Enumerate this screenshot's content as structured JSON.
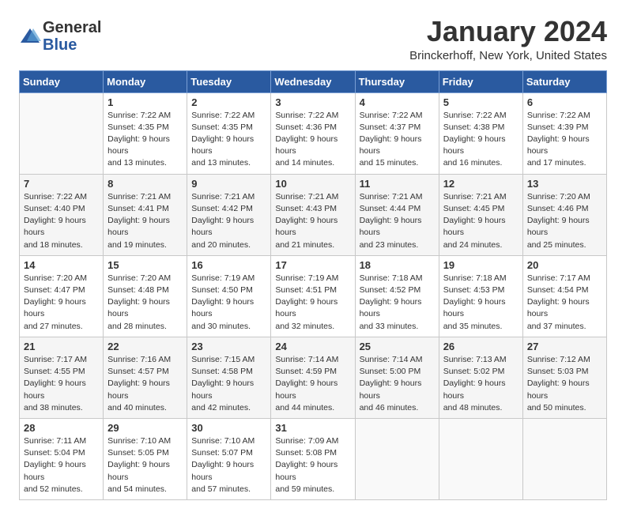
{
  "logo": {
    "general": "General",
    "blue": "Blue"
  },
  "header": {
    "month_title": "January 2024",
    "location": "Brinckerhoff, New York, United States"
  },
  "days_of_week": [
    "Sunday",
    "Monday",
    "Tuesday",
    "Wednesday",
    "Thursday",
    "Friday",
    "Saturday"
  ],
  "weeks": [
    [
      {
        "day": null,
        "data": null
      },
      {
        "day": "1",
        "data": "Sunrise: 7:22 AM\nSunset: 4:35 PM\nDaylight: 9 hours and 13 minutes."
      },
      {
        "day": "2",
        "data": "Sunrise: 7:22 AM\nSunset: 4:35 PM\nDaylight: 9 hours and 13 minutes."
      },
      {
        "day": "3",
        "data": "Sunrise: 7:22 AM\nSunset: 4:36 PM\nDaylight: 9 hours and 14 minutes."
      },
      {
        "day": "4",
        "data": "Sunrise: 7:22 AM\nSunset: 4:37 PM\nDaylight: 9 hours and 15 minutes."
      },
      {
        "day": "5",
        "data": "Sunrise: 7:22 AM\nSunset: 4:38 PM\nDaylight: 9 hours and 16 minutes."
      },
      {
        "day": "6",
        "data": "Sunrise: 7:22 AM\nSunset: 4:39 PM\nDaylight: 9 hours and 17 minutes."
      }
    ],
    [
      {
        "day": "7",
        "data": "Sunrise: 7:22 AM\nSunset: 4:40 PM\nDaylight: 9 hours and 18 minutes."
      },
      {
        "day": "8",
        "data": "Sunrise: 7:21 AM\nSunset: 4:41 PM\nDaylight: 9 hours and 19 minutes."
      },
      {
        "day": "9",
        "data": "Sunrise: 7:21 AM\nSunset: 4:42 PM\nDaylight: 9 hours and 20 minutes."
      },
      {
        "day": "10",
        "data": "Sunrise: 7:21 AM\nSunset: 4:43 PM\nDaylight: 9 hours and 21 minutes."
      },
      {
        "day": "11",
        "data": "Sunrise: 7:21 AM\nSunset: 4:44 PM\nDaylight: 9 hours and 23 minutes."
      },
      {
        "day": "12",
        "data": "Sunrise: 7:21 AM\nSunset: 4:45 PM\nDaylight: 9 hours and 24 minutes."
      },
      {
        "day": "13",
        "data": "Sunrise: 7:20 AM\nSunset: 4:46 PM\nDaylight: 9 hours and 25 minutes."
      }
    ],
    [
      {
        "day": "14",
        "data": "Sunrise: 7:20 AM\nSunset: 4:47 PM\nDaylight: 9 hours and 27 minutes."
      },
      {
        "day": "15",
        "data": "Sunrise: 7:20 AM\nSunset: 4:48 PM\nDaylight: 9 hours and 28 minutes."
      },
      {
        "day": "16",
        "data": "Sunrise: 7:19 AM\nSunset: 4:50 PM\nDaylight: 9 hours and 30 minutes."
      },
      {
        "day": "17",
        "data": "Sunrise: 7:19 AM\nSunset: 4:51 PM\nDaylight: 9 hours and 32 minutes."
      },
      {
        "day": "18",
        "data": "Sunrise: 7:18 AM\nSunset: 4:52 PM\nDaylight: 9 hours and 33 minutes."
      },
      {
        "day": "19",
        "data": "Sunrise: 7:18 AM\nSunset: 4:53 PM\nDaylight: 9 hours and 35 minutes."
      },
      {
        "day": "20",
        "data": "Sunrise: 7:17 AM\nSunset: 4:54 PM\nDaylight: 9 hours and 37 minutes."
      }
    ],
    [
      {
        "day": "21",
        "data": "Sunrise: 7:17 AM\nSunset: 4:55 PM\nDaylight: 9 hours and 38 minutes."
      },
      {
        "day": "22",
        "data": "Sunrise: 7:16 AM\nSunset: 4:57 PM\nDaylight: 9 hours and 40 minutes."
      },
      {
        "day": "23",
        "data": "Sunrise: 7:15 AM\nSunset: 4:58 PM\nDaylight: 9 hours and 42 minutes."
      },
      {
        "day": "24",
        "data": "Sunrise: 7:14 AM\nSunset: 4:59 PM\nDaylight: 9 hours and 44 minutes."
      },
      {
        "day": "25",
        "data": "Sunrise: 7:14 AM\nSunset: 5:00 PM\nDaylight: 9 hours and 46 minutes."
      },
      {
        "day": "26",
        "data": "Sunrise: 7:13 AM\nSunset: 5:02 PM\nDaylight: 9 hours and 48 minutes."
      },
      {
        "day": "27",
        "data": "Sunrise: 7:12 AM\nSunset: 5:03 PM\nDaylight: 9 hours and 50 minutes."
      }
    ],
    [
      {
        "day": "28",
        "data": "Sunrise: 7:11 AM\nSunset: 5:04 PM\nDaylight: 9 hours and 52 minutes."
      },
      {
        "day": "29",
        "data": "Sunrise: 7:10 AM\nSunset: 5:05 PM\nDaylight: 9 hours and 54 minutes."
      },
      {
        "day": "30",
        "data": "Sunrise: 7:10 AM\nSunset: 5:07 PM\nDaylight: 9 hours and 57 minutes."
      },
      {
        "day": "31",
        "data": "Sunrise: 7:09 AM\nSunset: 5:08 PM\nDaylight: 9 hours and 59 minutes."
      },
      {
        "day": null,
        "data": null
      },
      {
        "day": null,
        "data": null
      },
      {
        "day": null,
        "data": null
      }
    ]
  ]
}
